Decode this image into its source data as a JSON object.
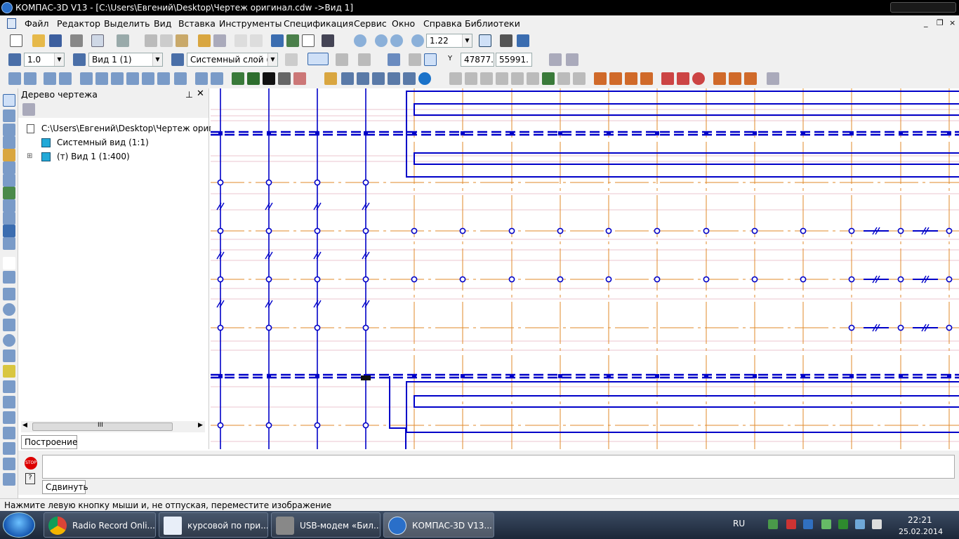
{
  "window": {
    "title": "КОМПАС-3D V13 - [C:\\Users\\Евгений\\Desktop\\Чертеж оригинал.cdw ->Вид 1]"
  },
  "menu": {
    "items": [
      "Файл",
      "Редактор",
      "Выделить",
      "Вид",
      "Вставка",
      "Инструменты",
      "Спецификация",
      "Сервис",
      "Окно",
      "Справка",
      "Библиотеки"
    ],
    "mdi": {
      "minimize": "_",
      "restore": "❐",
      "close": "×"
    }
  },
  "toolbar1": {
    "zoom_value": "1.22"
  },
  "toolbar2": {
    "scale_value": "1.0",
    "view_value": "Вид 1 (1)",
    "layer_value": "Системный слой (",
    "x_label": "Y",
    "coord_x": "47877.",
    "coord_y": "55991."
  },
  "tree": {
    "title": "Дерево чертежа",
    "root": "C:\\Users\\Евгений\\Desktop\\Чертеж оригина",
    "nodes": [
      "Системный вид (1:1)",
      "(т) Вид 1 (1:400)"
    ],
    "expander": "⊞",
    "tab": "Построение",
    "scroll_mark": "III"
  },
  "command": {
    "tab": "Сдвинуть",
    "stop_label": "STOP",
    "help_label": "?"
  },
  "status": {
    "text": "Нажмите левую кнопку мыши и, не отпуская, переместите изображение"
  },
  "taskbar": {
    "buttons": [
      "Radio Record Onli...",
      "курсовой по при...",
      "USB-модем «Бил...",
      "КОМПАС-3D V13..."
    ],
    "lang": "RU",
    "time": "22:21",
    "date": "25.02.2014"
  },
  "colors": {
    "drawing_blue": "#0000c8",
    "axis_orange": "#e08a2a",
    "thin_pink": "#d88aa0"
  }
}
